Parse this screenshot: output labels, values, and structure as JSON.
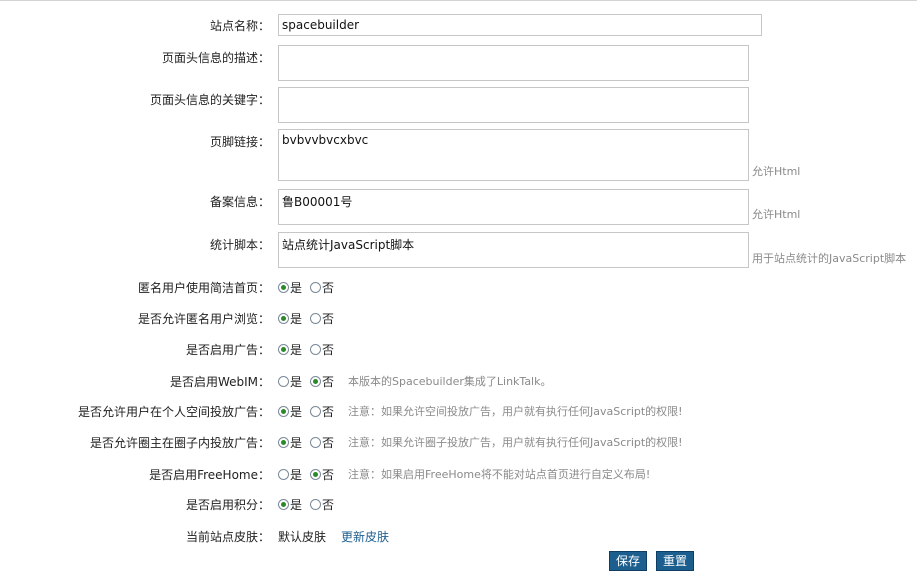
{
  "form": {
    "site_name": {
      "label": "站点名称：",
      "value": "spacebuilder"
    },
    "meta_description": {
      "label": "页面头信息的描述：",
      "value": ""
    },
    "meta_keywords": {
      "label": "页面头信息的关键字：",
      "value": ""
    },
    "footer_links": {
      "label": "页脚链接：",
      "value": "bvbvvbvcxbvc",
      "hint": "允许Html"
    },
    "icp_record": {
      "label": "备案信息：",
      "value": "鲁B00001号",
      "hint": "允许Html"
    },
    "stats_script": {
      "label": "统计脚本：",
      "value": "站点统计JavaScript脚本",
      "hint": "用于站点统计的JavaScript脚本"
    },
    "anonymous_simple_home": {
      "label": "匿名用户使用简洁首页：",
      "yes": "是",
      "no": "否",
      "selected": "yes"
    },
    "allow_anonymous_browse": {
      "label": "是否允许匿名用户浏览：",
      "yes": "是",
      "no": "否",
      "selected": "yes"
    },
    "enable_ads": {
      "label": "是否启用广告：",
      "yes": "是",
      "no": "否",
      "selected": "yes"
    },
    "enable_webim": {
      "label": "是否启用WebIM：",
      "yes": "是",
      "no": "否",
      "selected": "no",
      "note": "本版本的Spacebuilder集成了LinkTalk。"
    },
    "allow_user_space_ads": {
      "label": "是否允许用户在个人空间投放广告：",
      "yes": "是",
      "no": "否",
      "selected": "yes",
      "note": "注意：如果允许空间投放广告，用户就有执行任何JavaScript的权限!"
    },
    "allow_group_owner_ads": {
      "label": "是否允许圈主在圈子内投放广告：",
      "yes": "是",
      "no": "否",
      "selected": "yes",
      "note": "注意：如果允许圈子投放广告，用户就有执行任何JavaScript的权限!"
    },
    "enable_freehome": {
      "label": "是否启用FreeHome：",
      "yes": "是",
      "no": "否",
      "selected": "no",
      "note": "注意：如果启用FreeHome将不能对站点首页进行自定义布局!"
    },
    "enable_points": {
      "label": "是否启用积分：",
      "yes": "是",
      "no": "否",
      "selected": "yes"
    },
    "current_skin": {
      "label": "当前站点皮肤：",
      "value": "默认皮肤",
      "change_link": "更新皮肤"
    }
  },
  "actions": {
    "save_label": "保存",
    "reset_label": "重置"
  }
}
